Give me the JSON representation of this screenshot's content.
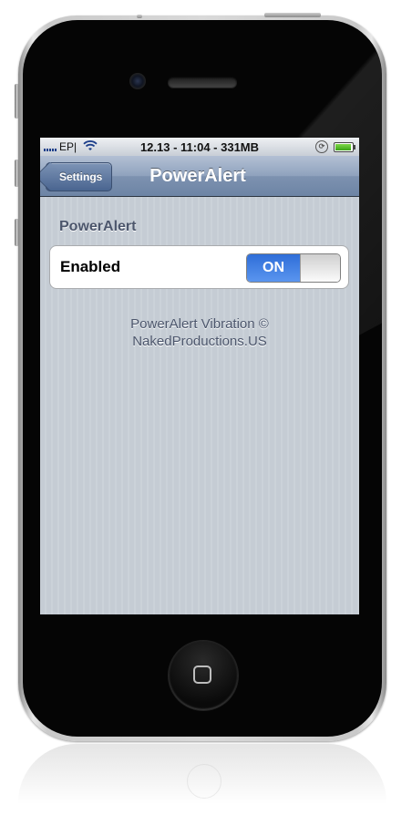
{
  "status_bar": {
    "carrier": "EP|",
    "center_text": "12.13 - 11:04 - 331MB",
    "wifi_icon": "wifi-icon",
    "lock_icon": "rotation-lock-icon",
    "battery_icon": "battery-icon",
    "battery_color": "#3aa416"
  },
  "navbar": {
    "back_label": "Settings",
    "title": "PowerAlert"
  },
  "section": {
    "header": "PowerAlert"
  },
  "enabled_row": {
    "label": "Enabled",
    "switch_state": "ON",
    "switch_color": "#2f6ed8"
  },
  "footer": {
    "line1": "PowerAlert Vibration ©",
    "line2": "NakedProductions.US"
  }
}
